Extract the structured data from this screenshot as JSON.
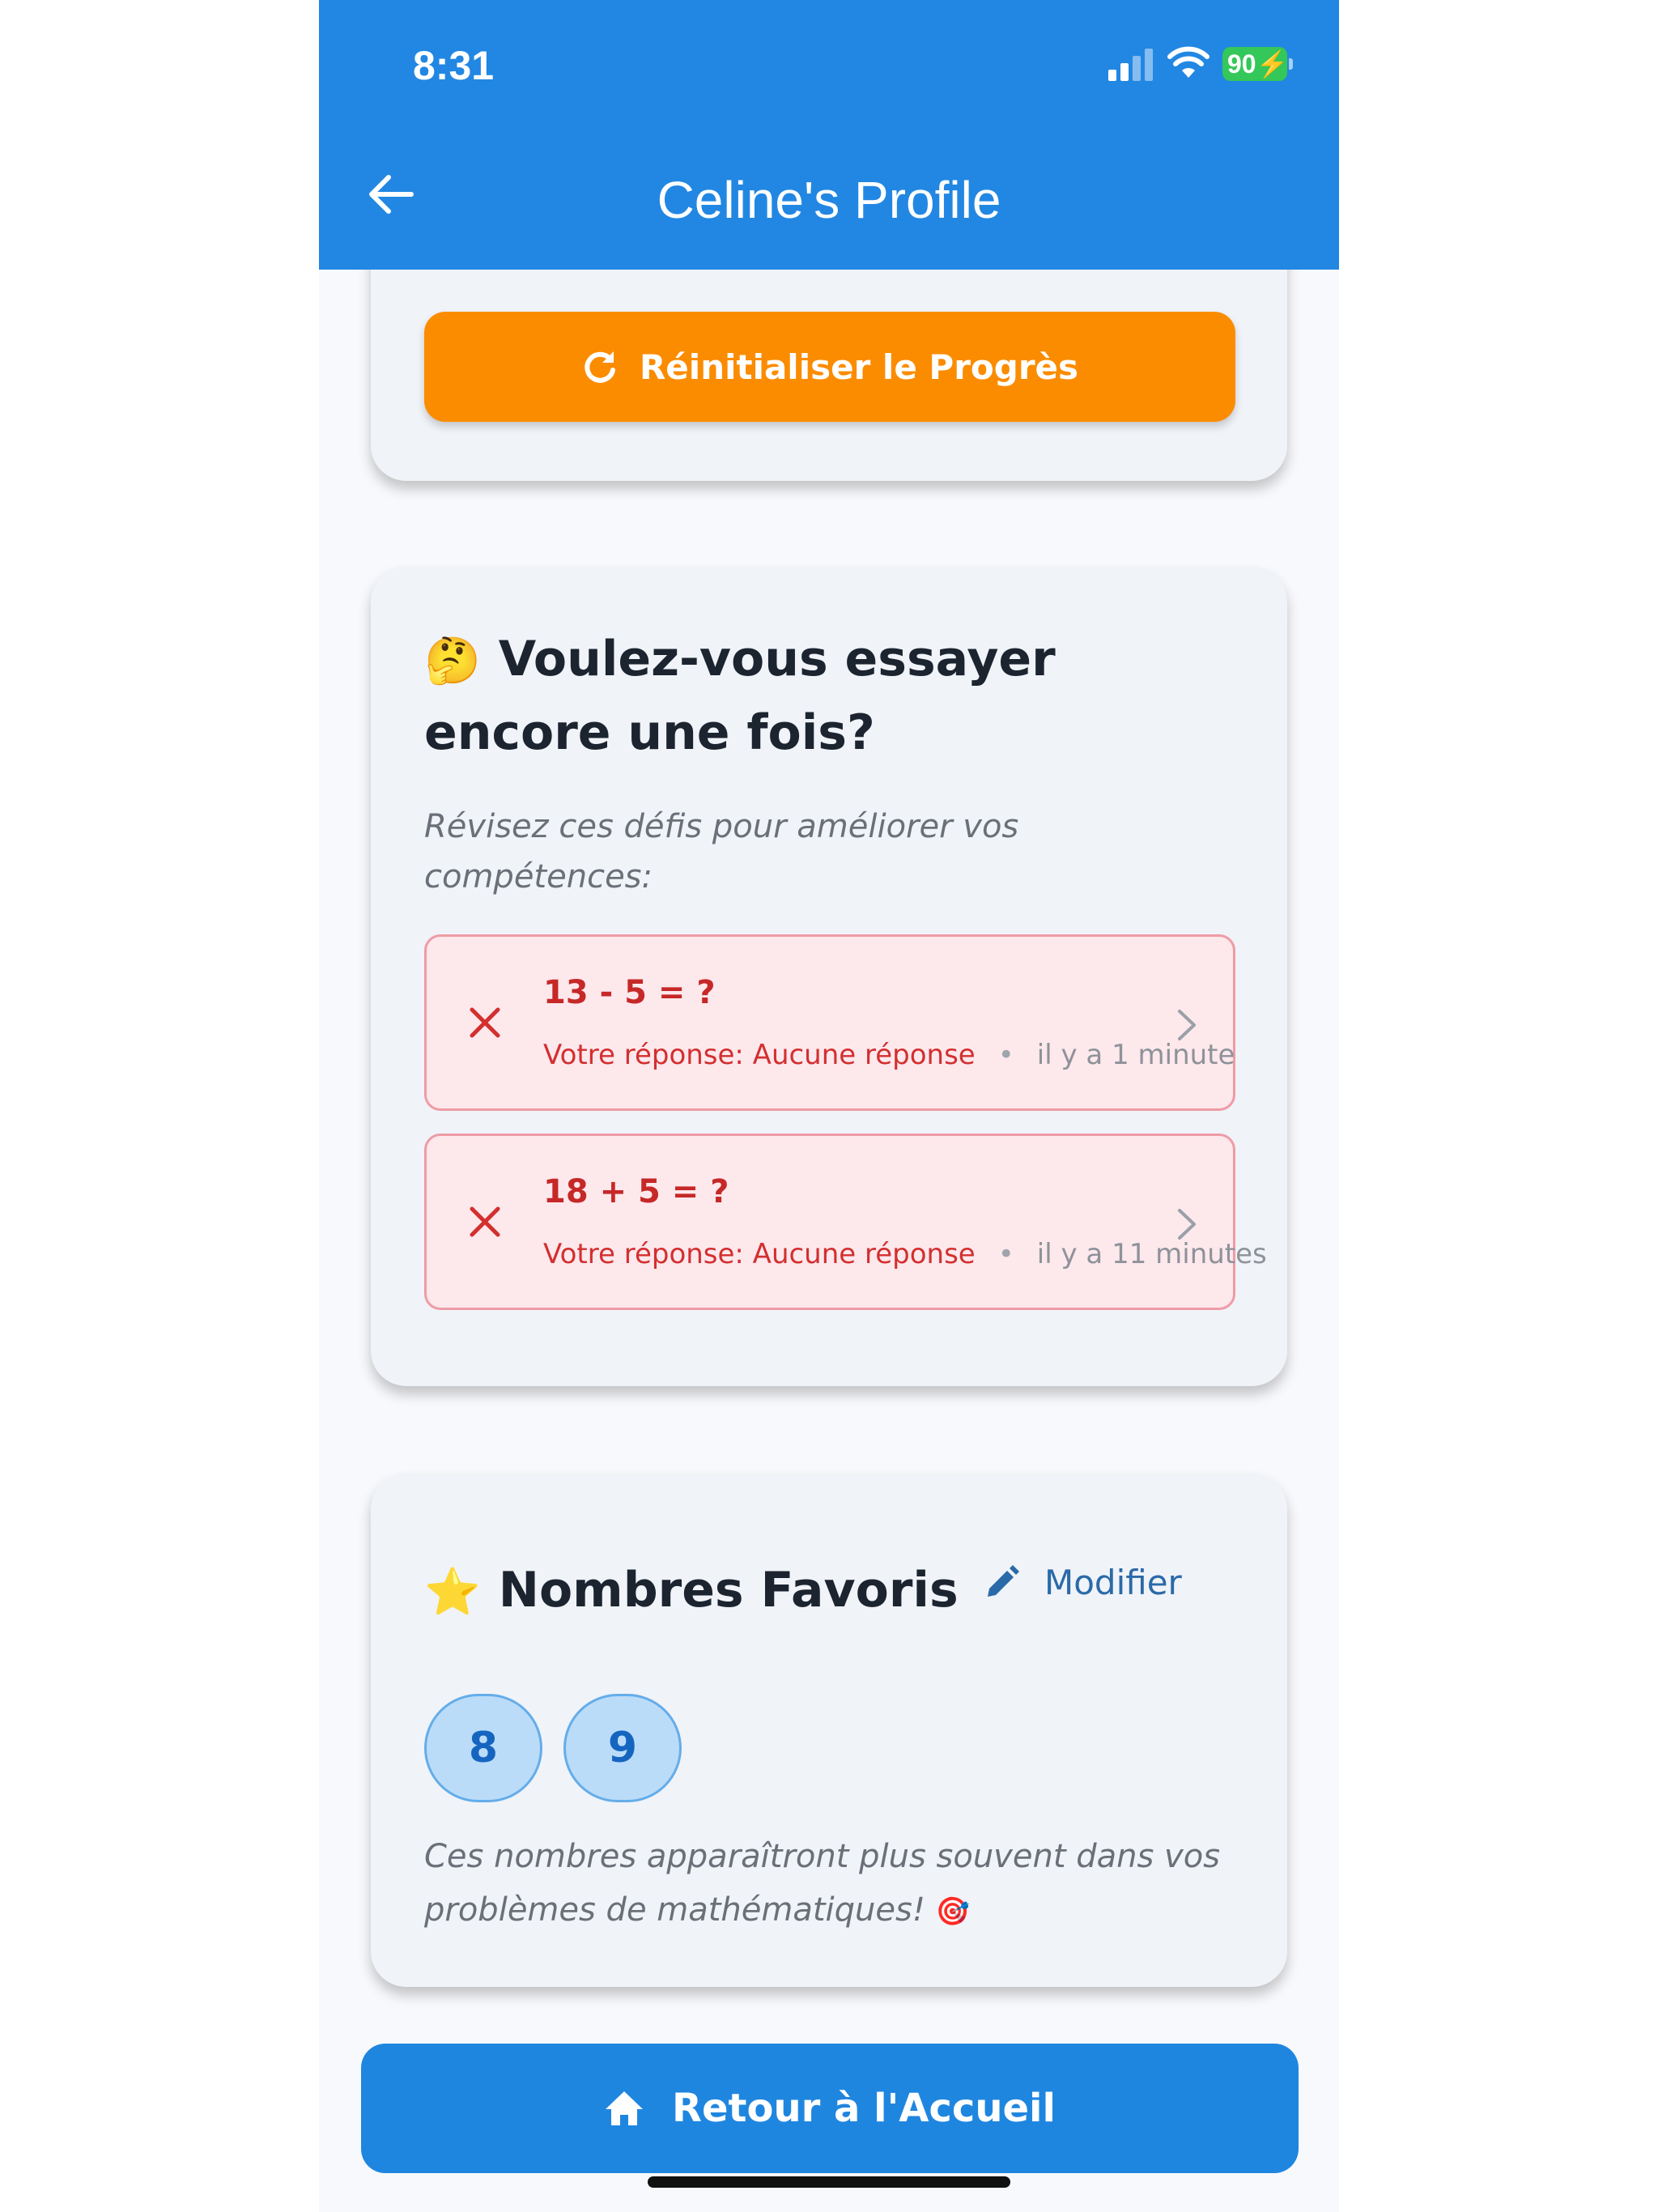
{
  "status_bar": {
    "time": "8:31",
    "battery": "90"
  },
  "header": {
    "title": "Celine's Profile"
  },
  "reset_card": {
    "button_label": "Réinitialiser le Progrès"
  },
  "retry_card": {
    "emoji": "🤔",
    "title": "Voulez-vous essayer encore une fois?",
    "subtitle": "Révisez ces défis pour améliorer vos compétences:",
    "challenges": [
      {
        "equation": "13 - 5 = ?",
        "answer": "Votre réponse: Aucune réponse",
        "time": "il y a 1 minute"
      },
      {
        "equation": "18 + 5 = ?",
        "answer": "Votre réponse: Aucune réponse",
        "time": "il y a 11 minutes"
      }
    ]
  },
  "favorites_card": {
    "emoji": "⭐",
    "title": "Nombres Favoris",
    "modify_label": "Modifier",
    "numbers": [
      "8",
      "9"
    ],
    "note": "Ces nombres apparaîtront plus souvent dans vos problèmes de mathématiques!",
    "note_emoji": "🎯"
  },
  "footer": {
    "home_button_label": "Retour à l'Accueil"
  },
  "colors": {
    "primary": "#2287e3",
    "reset_orange": "#fb8c00",
    "error_red": "#d32f2f",
    "chip_blue": "#bbdcf8"
  },
  "icons": [
    "back-arrow-icon",
    "refresh-icon",
    "close-icon",
    "chevron-right-icon",
    "pencil-icon",
    "home-icon"
  ]
}
